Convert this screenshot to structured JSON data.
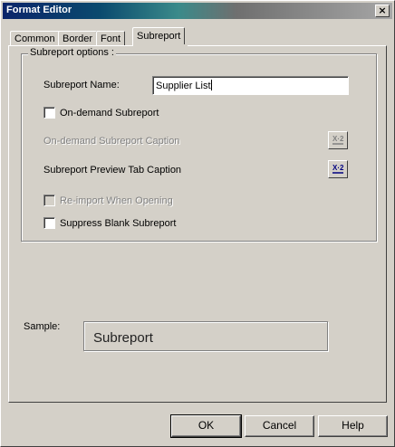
{
  "window": {
    "title": "Format Editor",
    "close_glyph": "×"
  },
  "tabs": [
    {
      "label": "Common",
      "active": false
    },
    {
      "label": "Border",
      "active": false
    },
    {
      "label": "Font",
      "active": false
    },
    {
      "label": "Subreport",
      "active": true
    }
  ],
  "group": {
    "legend": "Subreport options :",
    "name_label": "Subreport Name:",
    "name_value": "Supplier List",
    "on_demand_label": "On-demand Subreport",
    "on_demand_checked": false,
    "caption_label": "On-demand Subreport Caption",
    "caption_disabled": true,
    "preview_caption_label": "Subreport Preview Tab Caption",
    "reimport_label": "Re-import When Opening",
    "reimport_disabled": true,
    "suppress_label": "Suppress Blank Subreport",
    "suppress_checked": false,
    "formula_icon": "formula-x2-icon"
  },
  "sample": {
    "label": "Sample:",
    "text": "Subreport"
  },
  "buttons": {
    "ok": "OK",
    "cancel": "Cancel",
    "help": "Help"
  },
  "colors": {
    "face": "#d4d0c8",
    "title_start": "#0a246a",
    "disabled_text": "#808080"
  }
}
